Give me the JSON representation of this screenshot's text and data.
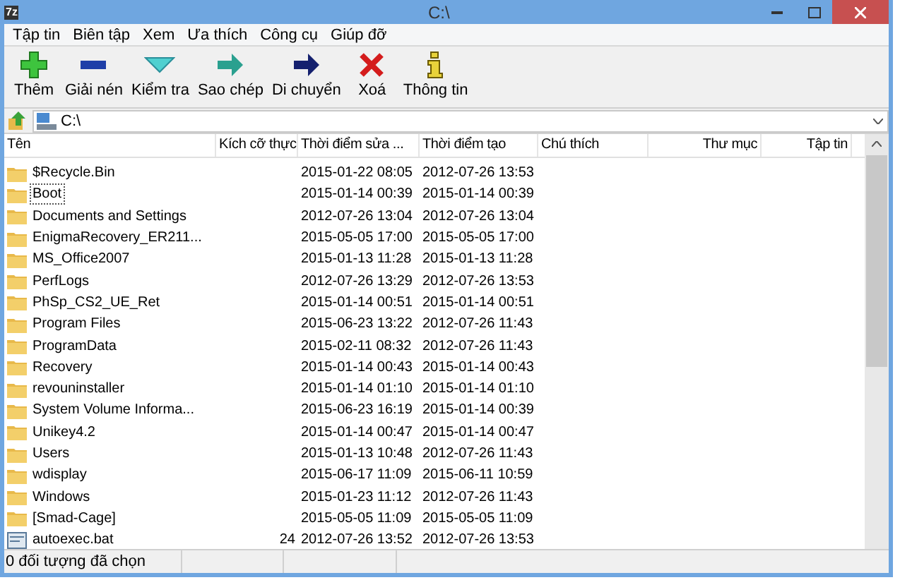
{
  "window": {
    "title": "C:\\",
    "logo": "7z"
  },
  "menu": [
    "Tập tin",
    "Biên tập",
    "Xem",
    "Ưa thích",
    "Công cụ",
    "Giúp đỡ"
  ],
  "toolbar": [
    {
      "kind": "add",
      "label": "Thêm"
    },
    {
      "kind": "extract",
      "label": "Giải nén"
    },
    {
      "kind": "test",
      "label": "Kiểm tra"
    },
    {
      "kind": "copy",
      "label": "Sao chép"
    },
    {
      "kind": "move",
      "label": "Di chuyển"
    },
    {
      "kind": "delete",
      "label": "Xoá"
    },
    {
      "kind": "info",
      "label": "Thông tin"
    }
  ],
  "address": {
    "value": "C:\\"
  },
  "table": {
    "columns": [
      "Tên",
      "Kích cỡ thực",
      "Thời điểm sửa ...",
      "Thời điểm tạo",
      "Chú thích",
      "Thư mục",
      "Tập tin"
    ],
    "rows": [
      {
        "kind": "folder",
        "name": "$Recycle.Bin",
        "size": "",
        "modified": "2015-01-22 08:05",
        "created": "2012-07-26 13:53",
        "focused": false
      },
      {
        "kind": "folder",
        "name": "Boot",
        "size": "",
        "modified": "2015-01-14 00:39",
        "created": "2015-01-14 00:39",
        "focused": true
      },
      {
        "kind": "folder",
        "name": "Documents and Settings",
        "size": "",
        "modified": "2012-07-26 13:04",
        "created": "2012-07-26 13:04",
        "focused": false
      },
      {
        "kind": "folder",
        "name": "EnigmaRecovery_ER211...",
        "size": "",
        "modified": "2015-05-05 17:00",
        "created": "2015-05-05 17:00",
        "focused": false
      },
      {
        "kind": "folder",
        "name": "MS_Office2007",
        "size": "",
        "modified": "2015-01-13 11:28",
        "created": "2015-01-13 11:28",
        "focused": false
      },
      {
        "kind": "folder",
        "name": "PerfLogs",
        "size": "",
        "modified": "2012-07-26 13:29",
        "created": "2012-07-26 13:53",
        "focused": false
      },
      {
        "kind": "folder",
        "name": "PhSp_CS2_UE_Ret",
        "size": "",
        "modified": "2015-01-14 00:51",
        "created": "2015-01-14 00:51",
        "focused": false
      },
      {
        "kind": "folder",
        "name": "Program Files",
        "size": "",
        "modified": "2015-06-23 13:22",
        "created": "2012-07-26 11:43",
        "focused": false
      },
      {
        "kind": "folder",
        "name": "ProgramData",
        "size": "",
        "modified": "2015-02-11 08:32",
        "created": "2012-07-26 11:43",
        "focused": false
      },
      {
        "kind": "folder",
        "name": "Recovery",
        "size": "",
        "modified": "2015-01-14 00:43",
        "created": "2015-01-14 00:43",
        "focused": false
      },
      {
        "kind": "folder",
        "name": "revouninstaller",
        "size": "",
        "modified": "2015-01-14 01:10",
        "created": "2015-01-14 01:10",
        "focused": false
      },
      {
        "kind": "folder",
        "name": "System Volume Informa...",
        "size": "",
        "modified": "2015-06-23 16:19",
        "created": "2015-01-14 00:39",
        "focused": false
      },
      {
        "kind": "folder",
        "name": "Unikey4.2",
        "size": "",
        "modified": "2015-01-14 00:47",
        "created": "2015-01-14 00:47",
        "focused": false
      },
      {
        "kind": "folder",
        "name": "Users",
        "size": "",
        "modified": "2015-01-13 10:48",
        "created": "2012-07-26 11:43",
        "focused": false
      },
      {
        "kind": "folder",
        "name": "wdisplay",
        "size": "",
        "modified": "2015-06-17 11:09",
        "created": "2015-06-11 10:59",
        "focused": false
      },
      {
        "kind": "folder",
        "name": "Windows",
        "size": "",
        "modified": "2015-01-23 11:12",
        "created": "2012-07-26 11:43",
        "focused": false
      },
      {
        "kind": "folder",
        "name": "[Smad-Cage]",
        "size": "",
        "modified": "2015-05-05 11:09",
        "created": "2015-05-05 11:09",
        "focused": false
      },
      {
        "kind": "file",
        "name": "autoexec.bat",
        "size": "24",
        "modified": "2012-07-26 13:52",
        "created": "2012-07-26 13:53",
        "focused": false
      }
    ]
  },
  "status_bar": {
    "text": "0 đối tượng đã chọn"
  }
}
